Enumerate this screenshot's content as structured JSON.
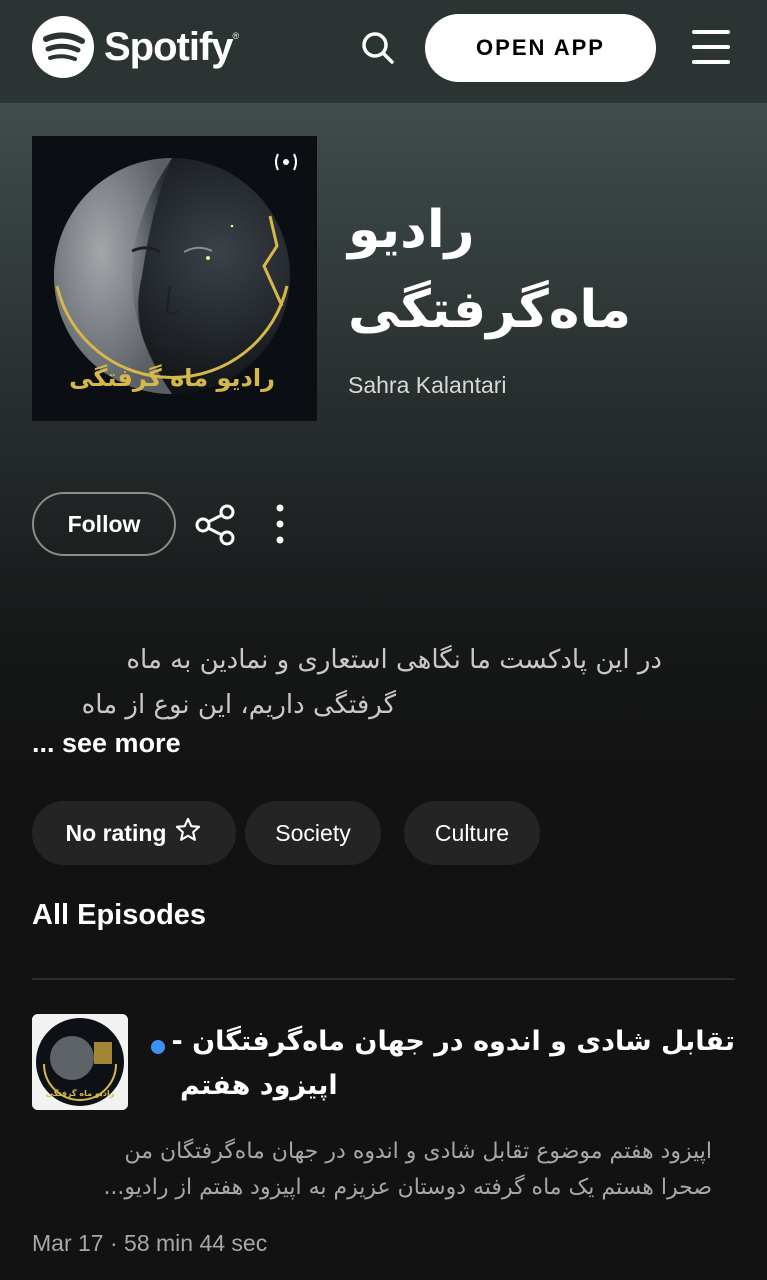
{
  "header": {
    "brand": "Spotify",
    "brand_mark": "®",
    "open_app_label": "OPEN APP",
    "search_icon": "search-icon",
    "menu_icon": "hamburger-menu-icon"
  },
  "podcast": {
    "title_line1": "رادیو",
    "title_line2": "ماه‌گرفتگی",
    "author": "Sahra Kalantari",
    "cover_caption": "رادیو ماه گرفتگی"
  },
  "actions": {
    "follow_label": "Follow",
    "share_icon": "share-icon",
    "more_icon": "more-options-icon"
  },
  "description": {
    "line1": "در این پادکست ما نگاهی استعاری و نمادین به ماه",
    "line2": "گرفتگی داریم، این نوع از ماه",
    "see_more": "... see more"
  },
  "chips": {
    "rating": "No rating",
    "society": "Society",
    "culture": "Culture"
  },
  "episodes_section": {
    "title": "All Episodes"
  },
  "episode": {
    "title_line1": "تقابل شادی و اندوه در جهان ماه‌گرفتگان -",
    "title_line2": "اپیزود هفتم",
    "desc_line1": "اپیزود هفتم موضوع تقابل شادی و اندوه در جهان ماه‌گرفتگان من",
    "desc_line2": "صحرا هستم یک ماه گرفته دوستان عزیزم به اپیزود هفتم از رادیو...",
    "meta": "Mar 17 · 58 min 44 sec",
    "new_indicator_color": "#3d91f4"
  },
  "colors": {
    "header_bg": "#2b3333",
    "page_bg": "#121212",
    "chip_bg": "#242424",
    "accent_gold": "#d6b74a"
  }
}
